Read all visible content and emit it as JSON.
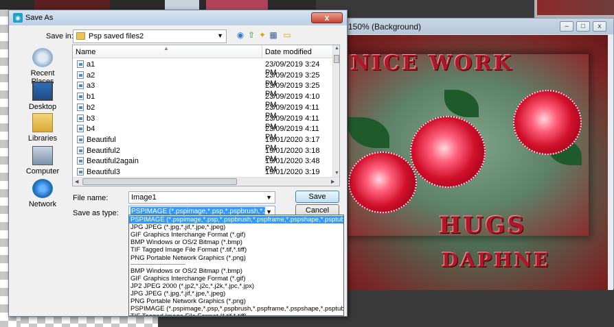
{
  "dialog": {
    "title": "Save As",
    "close_label": "x",
    "save_in_label": "Save in:",
    "save_in_value": "Psp saved files2",
    "places": [
      {
        "label": "Recent Places",
        "icon": "recent-places-icon"
      },
      {
        "label": "Desktop",
        "icon": "desktop-icon"
      },
      {
        "label": "Libraries",
        "icon": "libraries-icon"
      },
      {
        "label": "Computer",
        "icon": "computer-icon"
      },
      {
        "label": "Network",
        "icon": "network-icon"
      }
    ],
    "columns": {
      "name": "Name",
      "date": "Date modified"
    },
    "files": [
      {
        "name": "a1",
        "date": "23/09/2019 3:24 PM"
      },
      {
        "name": "a2",
        "date": "23/09/2019 3:25 PM"
      },
      {
        "name": "a3",
        "date": "23/09/2019 3:25 PM"
      },
      {
        "name": "b1",
        "date": "23/09/2019 4:10 PM"
      },
      {
        "name": "b2",
        "date": "23/09/2019 4:11 PM"
      },
      {
        "name": "b3",
        "date": "23/09/2019 4:11 PM"
      },
      {
        "name": "b4",
        "date": "23/09/2019 4:11 PM"
      },
      {
        "name": "Beautiful",
        "date": "19/01/2020 3:17 PM"
      },
      {
        "name": "Beautiful2",
        "date": "19/01/2020 3:18 PM"
      },
      {
        "name": "Beautiful2again",
        "date": "19/01/2020 3:48 PM"
      },
      {
        "name": "Beautiful3",
        "date": "19/01/2020 3:19 PM"
      }
    ],
    "file_name_label": "File name:",
    "file_name_value": "Image1",
    "save_as_type_label": "Save as type:",
    "save_as_type_value": "PSPIMAGE (*.pspimage,*.psp,*.pspbrush,*.pspfrar",
    "save_button": "Save",
    "cancel_button": "Cancel",
    "type_options_top": [
      "PSPIMAGE (*.pspimage,*.psp,*.pspbrush,*.pspframe,*.pspshape,*.psptube,*.tub)",
      "JPG JPEG (*.jpg,*.jif,*.jpe,*.jpeg)",
      "GIF Graphics Interchange Format (*.gif)",
      "BMP Windows or OS/2 Bitmap (*.bmp)",
      "TIF Tagged Image File Format (*.tif,*.tiff)",
      "PNG Portable Network Graphics (*.png)"
    ],
    "type_options_bottom": [
      "BMP Windows or OS/2 Bitmap (*.bmp)",
      "GIF Graphics Interchange Format (*.gif)",
      "JP2 JPEG 2000 (*.jp2,*.j2c,*.j2k,*.jpc,*.jpx)",
      "JPG JPEG (*.jpg,*.jif,*.jpe,*.jpeg)",
      "PNG Portable Network Graphics (*.png)",
      "PSPIMAGE (*.pspimage,*.psp,*.pspbrush,*.pspframe,*.pspshape,*.psptube,*.tub)",
      "TIF Tagged Image File Format (*.tif,*.tiff)"
    ]
  },
  "image_window": {
    "title": "150% (Background)",
    "min_label": "–",
    "max_label": "□",
    "close_label": "x"
  },
  "canvas": {
    "line1": "NICE WORK",
    "line2": "HUGS",
    "line3": "DAPHNE"
  }
}
